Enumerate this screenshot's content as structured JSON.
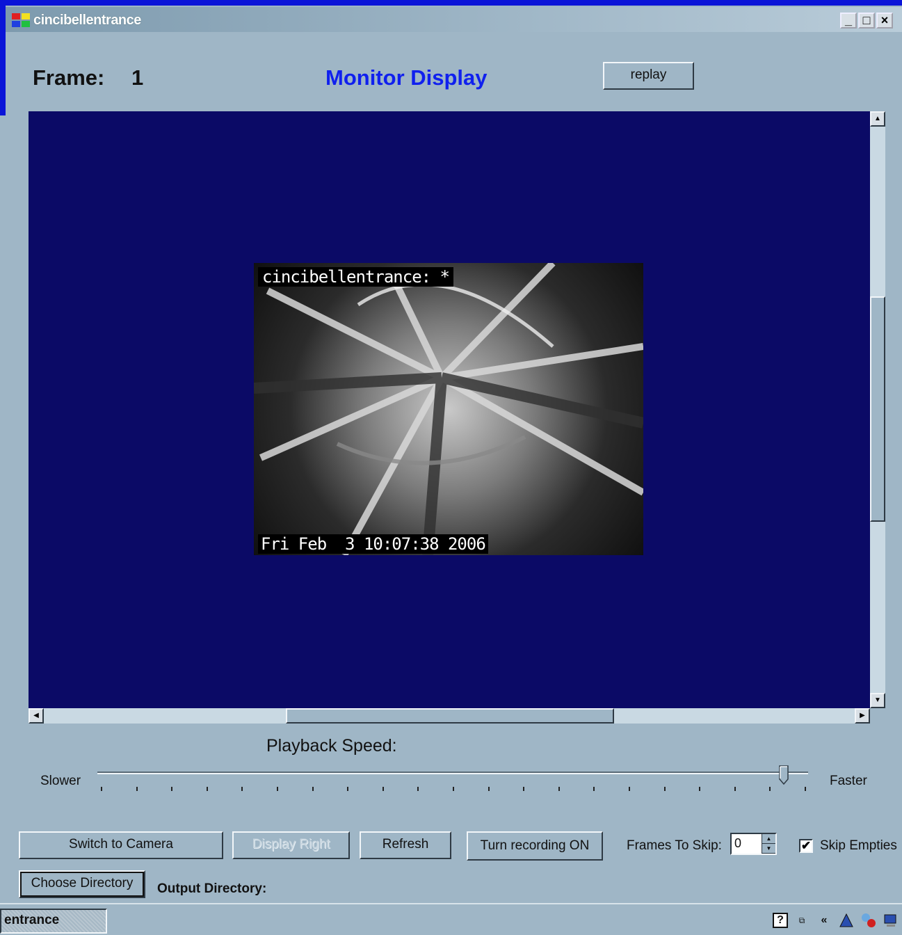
{
  "window": {
    "title": "cincibellentrance",
    "minimize": "_",
    "maximize": "□",
    "close": "×"
  },
  "header": {
    "frame_label": "Frame:",
    "frame_value": "1",
    "monitor_title": "Monitor Display",
    "replay_label": "replay"
  },
  "camera": {
    "overlay_top": "cincibellentrance: *",
    "overlay_bottom": "Fri Feb  3 10:07:38 2006"
  },
  "playback": {
    "label": "Playback Speed:",
    "slower": "Slower",
    "faster": "Faster",
    "speed_fraction": 0.97,
    "tick_count": 21
  },
  "buttons": {
    "switch_camera": "Switch to Camera",
    "display_right": "Display Right",
    "refresh": "Refresh",
    "recording": "Turn recording ON",
    "choose_directory": "Choose Directory"
  },
  "frames_to_skip": {
    "label": "Frames To Skip:",
    "value": "0"
  },
  "skip_empties": {
    "label": "Skip Empties",
    "checked": true
  },
  "output_directory": {
    "label": "Output Directory:"
  },
  "taskbar": {
    "task_label": "entrance"
  },
  "colors": {
    "accent_title": "#1020ee",
    "viewport_bg": "#0b0a66",
    "form_bg": "#9fb6c6"
  }
}
